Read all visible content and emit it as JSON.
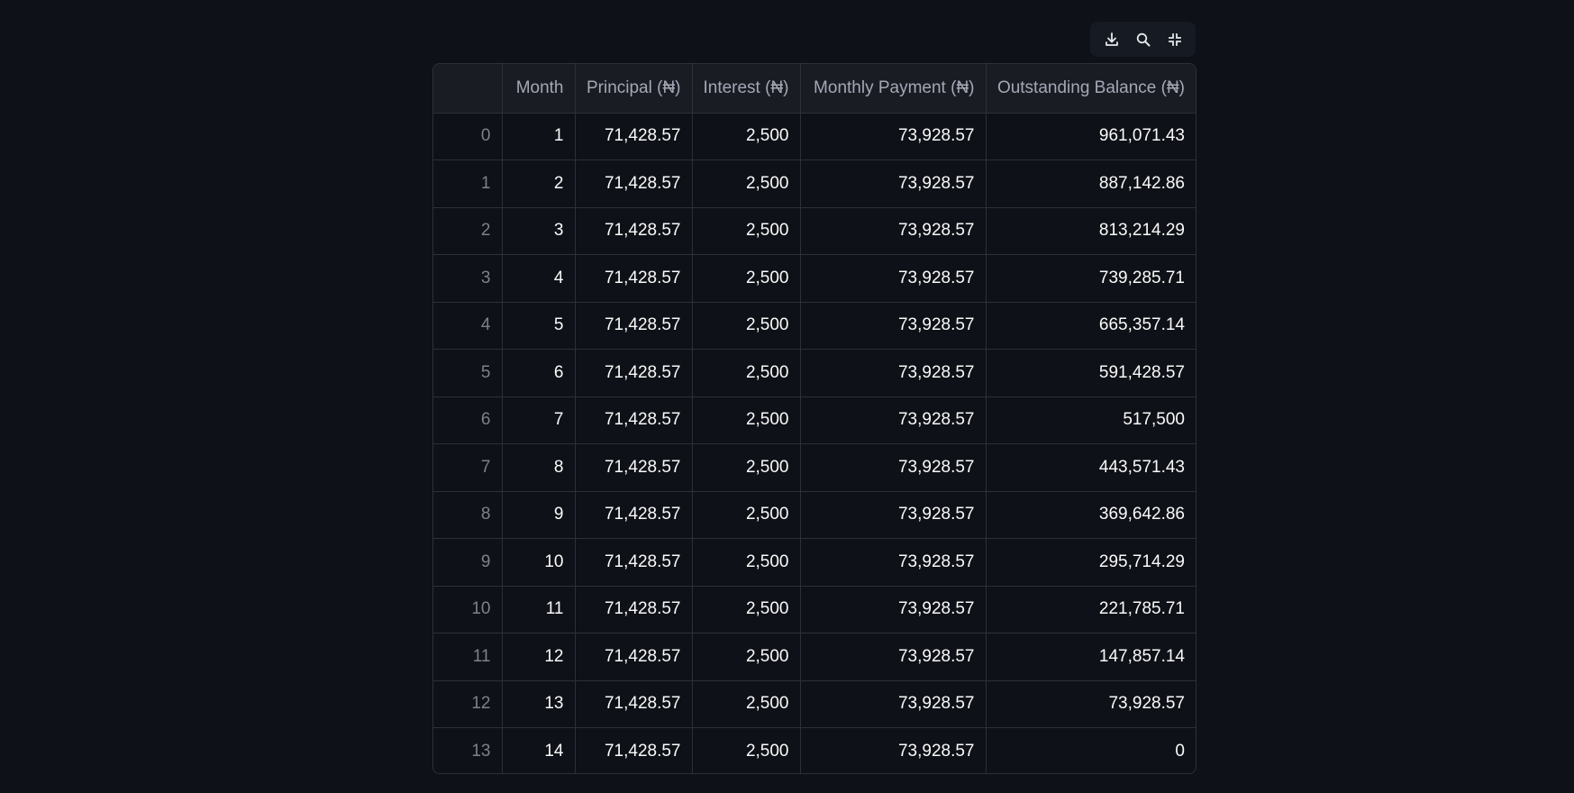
{
  "toolbar": {
    "download_icon": "download-icon",
    "search_icon": "search-icon",
    "collapse_icon": "collapse-icon"
  },
  "table": {
    "columns": [
      "",
      "Month",
      "Principal (₦)",
      "Interest (₦)",
      "Monthly Payment (₦)",
      "Outstanding Balance (₦)"
    ],
    "rows": [
      [
        "0",
        "1",
        "71,428.57",
        "2,500",
        "73,928.57",
        "961,071.43"
      ],
      [
        "1",
        "2",
        "71,428.57",
        "2,500",
        "73,928.57",
        "887,142.86"
      ],
      [
        "2",
        "3",
        "71,428.57",
        "2,500",
        "73,928.57",
        "813,214.29"
      ],
      [
        "3",
        "4",
        "71,428.57",
        "2,500",
        "73,928.57",
        "739,285.71"
      ],
      [
        "4",
        "5",
        "71,428.57",
        "2,500",
        "73,928.57",
        "665,357.14"
      ],
      [
        "5",
        "6",
        "71,428.57",
        "2,500",
        "73,928.57",
        "591,428.57"
      ],
      [
        "6",
        "7",
        "71,428.57",
        "2,500",
        "73,928.57",
        "517,500"
      ],
      [
        "7",
        "8",
        "71,428.57",
        "2,500",
        "73,928.57",
        "443,571.43"
      ],
      [
        "8",
        "9",
        "71,428.57",
        "2,500",
        "73,928.57",
        "369,642.86"
      ],
      [
        "9",
        "10",
        "71,428.57",
        "2,500",
        "73,928.57",
        "295,714.29"
      ],
      [
        "10",
        "11",
        "71,428.57",
        "2,500",
        "73,928.57",
        "221,785.71"
      ],
      [
        "11",
        "12",
        "71,428.57",
        "2,500",
        "73,928.57",
        "147,857.14"
      ],
      [
        "12",
        "13",
        "71,428.57",
        "2,500",
        "73,928.57",
        "73,928.57"
      ],
      [
        "13",
        "14",
        "71,428.57",
        "2,500",
        "73,928.57",
        "0"
      ]
    ]
  }
}
